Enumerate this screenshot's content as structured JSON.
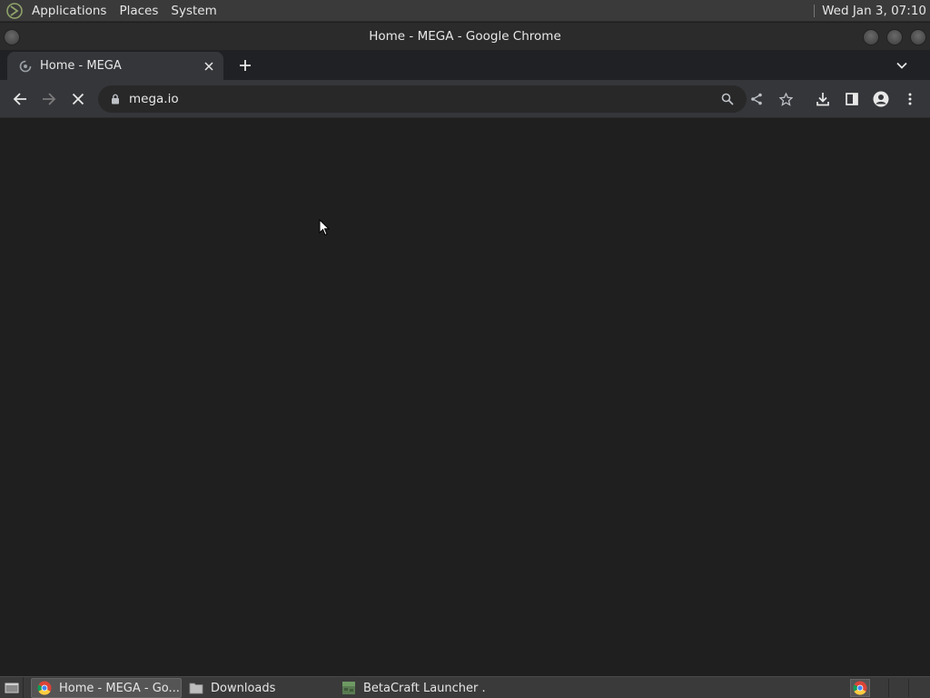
{
  "top_panel": {
    "menus": [
      "Applications",
      "Places",
      "System"
    ],
    "clock": "Wed Jan  3, 07:10"
  },
  "window": {
    "title": "Home - MEGA - Google Chrome"
  },
  "browser": {
    "tab": {
      "title": "Home - MEGA"
    },
    "omnibox": {
      "url": "mega.io"
    },
    "loading": true
  },
  "taskbar": {
    "tasks": [
      {
        "label": "Home - MEGA - Go...",
        "active": true
      },
      {
        "label": "Downloads",
        "active": false
      },
      {
        "label": "BetaCraft Launcher ...",
        "active": false
      }
    ]
  },
  "colors": {
    "panel": "#3a3a3a",
    "tabstrip": "#202124",
    "toolbar": "#35363a",
    "content": "#1f1f1f"
  }
}
